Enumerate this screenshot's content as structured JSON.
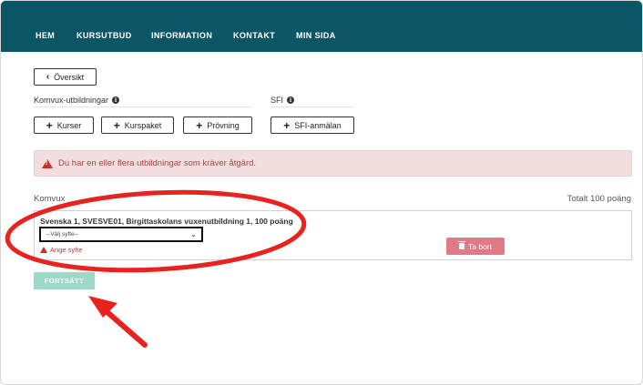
{
  "nav": {
    "items": [
      "HEM",
      "KURSUTBUD",
      "INFORMATION",
      "KONTAKT",
      "MIN SIDA"
    ]
  },
  "back_button": {
    "label": "Översikt"
  },
  "sections": {
    "komvux_label": "Komvux-utbildningar",
    "sfi_label": "SFI"
  },
  "buttons": {
    "kurser": "Kurser",
    "kurspaket": "Kurspaket",
    "provning": "Prövning",
    "sfi_anmalan": "SFI-anmälan"
  },
  "alert": {
    "text": "Du har en eller flera utbildningar som kräver åtgärd."
  },
  "komvux": {
    "heading": "Komvux",
    "total": "Totalt 100 poäng"
  },
  "course": {
    "title": "Svenska 1, SVESVE01, Birgittaskolans vuxenutbildning 1, 100 poäng",
    "select_value": "--Välj syfte--",
    "warning": "Ange syfte",
    "delete_label": "Ta bort"
  },
  "continue_button": {
    "label": "FORTSÄTT"
  },
  "colors": {
    "navbar": "#0b5664",
    "alert_text": "#a94442",
    "annotation": "#e8231f",
    "continue": "#9cd9c7",
    "delete": "#e07a84"
  }
}
